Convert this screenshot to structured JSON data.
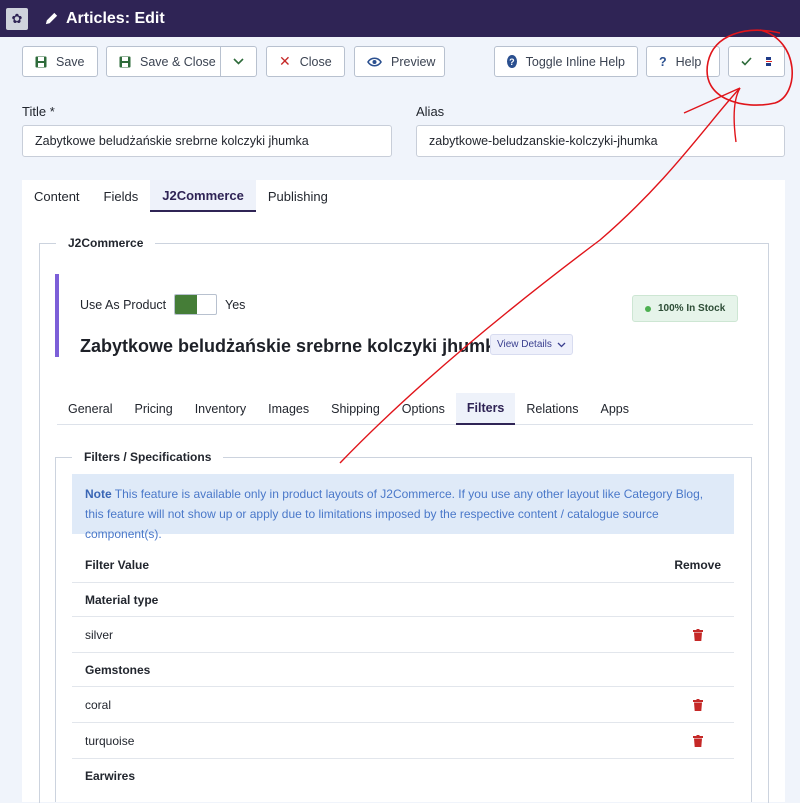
{
  "app": {
    "title": "Articles: Edit"
  },
  "toolbar": {
    "save": "Save",
    "save_close": "Save & Close",
    "close": "Close",
    "preview": "Preview",
    "toggle_help": "Toggle Inline Help",
    "help": "Help"
  },
  "fields": {
    "title_label": "Title *",
    "title_value": "Zabytkowe beludżańskie srebrne kolczyki jhumka",
    "alias_label": "Alias",
    "alias_value": "zabytkowe-beludzanskie-kolczyki-jhumka"
  },
  "main_tabs": [
    "Content",
    "Fields",
    "J2Commerce",
    "Publishing"
  ],
  "j2commerce": {
    "legend": "J2Commerce",
    "use_as_product_label": "Use As Product",
    "use_as_product_value": "Yes",
    "stock_badge": "100% In Stock",
    "product_name": "Zabytkowe beludżańskie srebrne kolczyki jhumka",
    "view_details": "View Details",
    "sub_tabs": [
      "General",
      "Pricing",
      "Inventory",
      "Images",
      "Shipping",
      "Options",
      "Filters",
      "Relations",
      "Apps"
    ]
  },
  "filters": {
    "legend": "Filters / Specifications",
    "note_label": "Note",
    "note_text": "This feature is available only in product layouts of J2Commerce. If you use any other layout like Category Blog, this feature will not show up or apply due to limitations imposed by the respective content / catalogue source component(s).",
    "col_value": "Filter Value",
    "col_remove": "Remove",
    "rows": [
      {
        "type": "group",
        "label": "Material type"
      },
      {
        "type": "item",
        "label": "silver"
      },
      {
        "type": "group",
        "label": "Gemstones"
      },
      {
        "type": "item",
        "label": "coral"
      },
      {
        "type": "item",
        "label": "turquoise"
      },
      {
        "type": "group",
        "label": "Earwires"
      }
    ]
  },
  "colors": {
    "topbar": "#2f2455",
    "accent": "#7c5fd8",
    "annotation": "#e0141a",
    "danger": "#c52827",
    "success": "#457d37"
  }
}
